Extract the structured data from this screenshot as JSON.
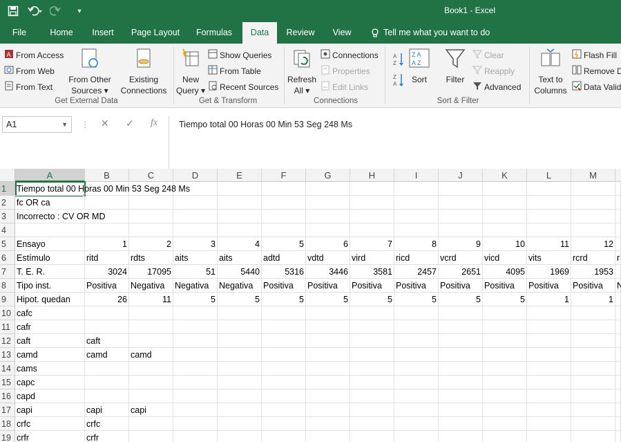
{
  "window": {
    "title": "Book1 - Excel"
  },
  "qat": {
    "customize": "▾"
  },
  "tabs": [
    {
      "label": "File"
    },
    {
      "label": "Home"
    },
    {
      "label": "Insert"
    },
    {
      "label": "Page Layout"
    },
    {
      "label": "Formulas"
    },
    {
      "label": "Data"
    },
    {
      "label": "Review"
    },
    {
      "label": "View"
    }
  ],
  "tellme": {
    "label": "Tell me what you want to do"
  },
  "ribbon": {
    "get_external": {
      "from_access": "From Access",
      "from_web": "From Web",
      "from_text": "From Text",
      "from_other_1": "From Other",
      "from_other_2": "Sources ▾",
      "existing_1": "Existing",
      "existing_2": "Connections",
      "label": "Get External Data"
    },
    "transform": {
      "new_query_1": "New",
      "new_query_2": "Query ▾",
      "show_queries": "Show Queries",
      "from_table": "From Table",
      "recent_sources": "Recent Sources",
      "label": "Get & Transform"
    },
    "connections": {
      "refresh_1": "Refresh",
      "refresh_2": "All ▾",
      "connections": "Connections",
      "properties": "Properties",
      "edit_links": "Edit Links",
      "label": "Connections"
    },
    "sort_filter": {
      "sort": "Sort",
      "filter": "Filter",
      "clear": "Clear",
      "reapply": "Reapply",
      "advanced": "Advanced",
      "label": "Sort & Filter"
    },
    "data_tools": {
      "text_to_1": "Text to",
      "text_to_2": "Columns",
      "flash_fill": "Flash Fill",
      "remove_dup": "Remove D",
      "data_valid": "Data Valid"
    }
  },
  "formula_bar": {
    "name_box": "A1",
    "fx": "fx",
    "formula": "Tiempo total 00 Horas 00 Min 53 Seg 248 Ms"
  },
  "columns": [
    "A",
    "B",
    "C",
    "D",
    "E",
    "F",
    "G",
    "H",
    "I",
    "J",
    "K",
    "L",
    "M"
  ],
  "rows": [
    {
      "n": "1",
      "cells": [
        "Tiempo total 00 Horas 00 Min 53 Seg 248 Ms",
        "",
        "",
        "",
        "",
        "",
        "",
        "",
        "",
        "",
        "",
        "",
        ""
      ]
    },
    {
      "n": "2",
      "cells": [
        "fc OR ca",
        "",
        "",
        "",
        "",
        "",
        "",
        "",
        "",
        "",
        "",
        "",
        ""
      ]
    },
    {
      "n": "3",
      "cells": [
        "Incorrecto : CV OR MD",
        "",
        "",
        "",
        "",
        "",
        "",
        "",
        "",
        "",
        "",
        "",
        ""
      ]
    },
    {
      "n": "4",
      "cells": [
        "",
        "",
        "",
        "",
        "",
        "",
        "",
        "",
        "",
        "",
        "",
        "",
        ""
      ]
    },
    {
      "n": "5",
      "cells": [
        "Ensayo",
        "1",
        "2",
        "3",
        "4",
        "5",
        "6",
        "7",
        "8",
        "9",
        "10",
        "11",
        "12"
      ]
    },
    {
      "n": "6",
      "cells": [
        "Estímulo",
        "ritd",
        "rdts",
        "aits",
        "aits",
        "adtd",
        "vdtd",
        "vird",
        "ricd",
        "vcrd",
        "vicd",
        "vits",
        "rcrd"
      ]
    },
    {
      "n": "7",
      "cells": [
        "T. E. R.",
        "3024",
        "17095",
        "51",
        "5440",
        "5316",
        "3446",
        "3581",
        "2457",
        "2651",
        "4095",
        "1969",
        "1953"
      ]
    },
    {
      "n": "8",
      "cells": [
        "Tipo inst.",
        "Positiva",
        "Negativa",
        "Negativa",
        "Negativa",
        "Positiva",
        "Positiva",
        "Positiva",
        "Positiva",
        "Positiva",
        "Positiva",
        "Positiva",
        "Positiva"
      ]
    },
    {
      "n": "9",
      "cells": [
        "Hipot. quedan",
        "26",
        "11",
        "5",
        "5",
        "5",
        "5",
        "5",
        "5",
        "5",
        "5",
        "1",
        "1"
      ]
    },
    {
      "n": "10",
      "cells": [
        "cafc",
        "",
        "",
        "",
        "",
        "",
        "",
        "",
        "",
        "",
        "",
        "",
        ""
      ]
    },
    {
      "n": "11",
      "cells": [
        "cafr",
        "",
        "",
        "",
        "",
        "",
        "",
        "",
        "",
        "",
        "",
        "",
        ""
      ]
    },
    {
      "n": "12",
      "cells": [
        "caft",
        "caft",
        "",
        "",
        "",
        "",
        "",
        "",
        "",
        "",
        "",
        "",
        ""
      ]
    },
    {
      "n": "13",
      "cells": [
        "camd",
        "camd",
        "camd",
        "",
        "",
        "",
        "",
        "",
        "",
        "",
        "",
        "",
        ""
      ]
    },
    {
      "n": "14",
      "cells": [
        "cams",
        "",
        "",
        "",
        "",
        "",
        "",
        "",
        "",
        "",
        "",
        "",
        ""
      ]
    },
    {
      "n": "15",
      "cells": [
        "capc",
        "",
        "",
        "",
        "",
        "",
        "",
        "",
        "",
        "",
        "",
        "",
        ""
      ]
    },
    {
      "n": "16",
      "cells": [
        "capd",
        "",
        "",
        "",
        "",
        "",
        "",
        "",
        "",
        "",
        "",
        "",
        ""
      ]
    },
    {
      "n": "17",
      "cells": [
        "capi",
        "capi",
        "capi",
        "",
        "",
        "",
        "",
        "",
        "",
        "",
        "",
        "",
        ""
      ]
    },
    {
      "n": "18",
      "cells": [
        "crfc",
        "crfc",
        "",
        "",
        "",
        "",
        "",
        "",
        "",
        "",
        "",
        "",
        ""
      ]
    },
    {
      "n": "19",
      "cells": [
        "crfr",
        "crfr",
        "",
        "",
        "",
        "",
        "",
        "",
        "",
        "",
        "",
        "",
        ""
      ]
    }
  ],
  "overflow_col_n": [
    "",
    "",
    "",
    "",
    "",
    "r",
    "",
    "N",
    "",
    "",
    "",
    "",
    "",
    "",
    "",
    "",
    "",
    "",
    ""
  ]
}
